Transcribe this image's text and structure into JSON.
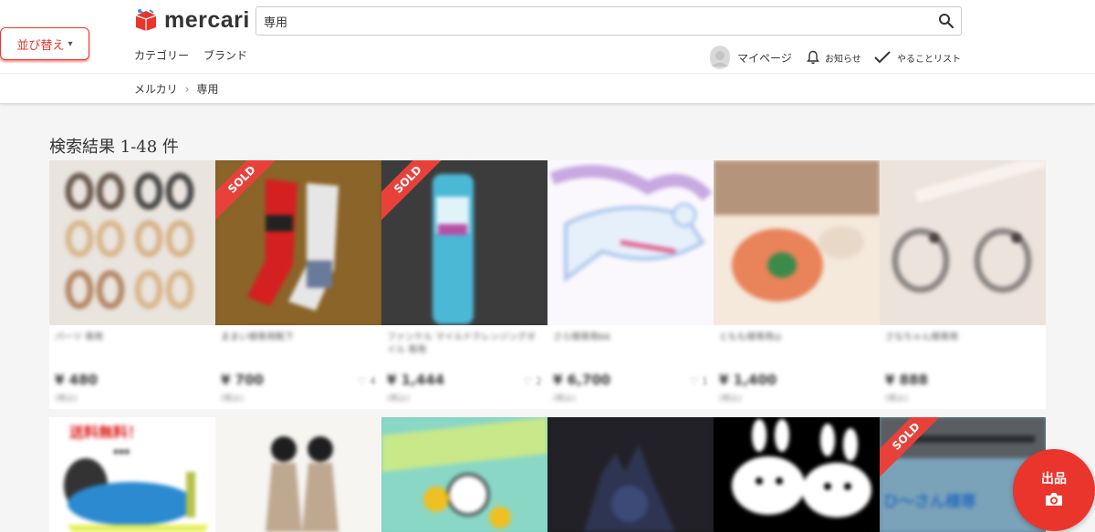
{
  "header": {
    "logo_text": "mercari",
    "search_value": "専用",
    "nav": {
      "category": "カテゴリー",
      "brand": "ブランド"
    },
    "user": {
      "mypage": "マイページ",
      "notifications": "お知らせ",
      "todo": "やることリスト"
    }
  },
  "sort_button": {
    "label": "並び替え"
  },
  "breadcrumb": {
    "root": "メルカリ",
    "current": "専用"
  },
  "results": {
    "title": "検索結果 1-48 件"
  },
  "items_row1": [
    {
      "name": "パーツ 専用",
      "price": "¥ 480",
      "tax": "(税込)",
      "sold": "",
      "likes": ""
    },
    {
      "name": "ままい様専用靴下",
      "price": "¥ 700",
      "tax": "(税込)",
      "sold": "SOLD",
      "likes": "4"
    },
    {
      "name": "ファンケル マイルドクレンジングオイル 専用",
      "price": "¥ 1,444",
      "tax": "(税込)",
      "sold": "SOLD",
      "likes": "2"
    },
    {
      "name": "さら様専用66",
      "price": "¥ 6,700",
      "tax": "(税込)",
      "sold": "",
      "likes": "1"
    },
    {
      "name": "ともも様専用◎",
      "price": "¥ 1,400",
      "tax": "(税込)",
      "sold": "",
      "likes": ""
    },
    {
      "name": "さなちゃん様専用",
      "price": "¥ 888",
      "tax": "(税込)",
      "sold": "",
      "likes": ""
    }
  ],
  "items_row2": [
    {
      "banner": "送料無料！",
      "sold": ""
    },
    {
      "banner": "",
      "sold": ""
    },
    {
      "banner": "",
      "sold": ""
    },
    {
      "banner": "",
      "sold": ""
    },
    {
      "banner": "",
      "sold": ""
    },
    {
      "banner": "ひ〜さん様専",
      "sold": "SOLD"
    }
  ],
  "fab": {
    "label": "出品"
  },
  "colors": {
    "accent": "#ea352d",
    "sold": "#e8413a"
  }
}
